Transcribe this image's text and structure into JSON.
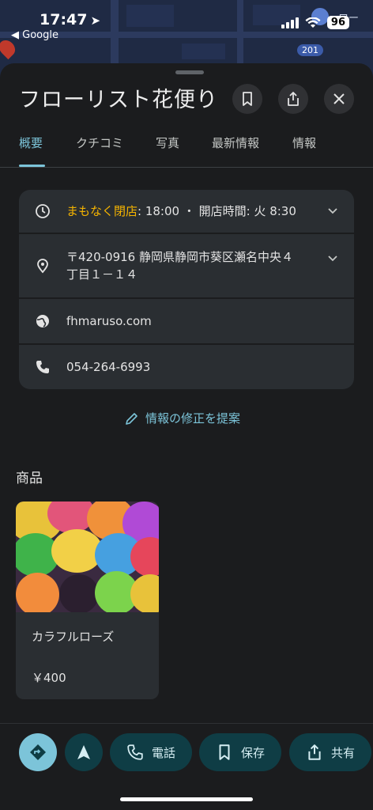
{
  "status_bar": {
    "time": "17:47",
    "back_app": "◀ Google",
    "battery": "96"
  },
  "map": {
    "route_badge": "201",
    "place_label": "ロー"
  },
  "place": {
    "title": "フローリスト花便り"
  },
  "tabs": [
    {
      "label": "概要"
    },
    {
      "label": "クチコミ"
    },
    {
      "label": "写真"
    },
    {
      "label": "最新情報"
    },
    {
      "label": "情報"
    }
  ],
  "info": {
    "hours_status": "まもなく閉店",
    "hours_detail": ": 18:00 ・ 開店時間: 火 8:30",
    "address_line1": "〒420-0916 静岡県静岡市葵区瀬名中央４",
    "address_line2": "丁目１－１４",
    "website": "fhmaruso.com",
    "phone": "054-264-6993",
    "suggest_edit": "情報の修正を提案"
  },
  "products": {
    "section_title": "商品",
    "items": [
      {
        "name": "カラフルローズ",
        "price": "￥400"
      }
    ]
  },
  "actions": {
    "call": "電話",
    "save": "保存",
    "share": "共有"
  },
  "colors": {
    "accent": "#7cc4d9",
    "hours_status": "#f5b400",
    "background": "#1b1c1e",
    "card": "#2a2e32"
  }
}
